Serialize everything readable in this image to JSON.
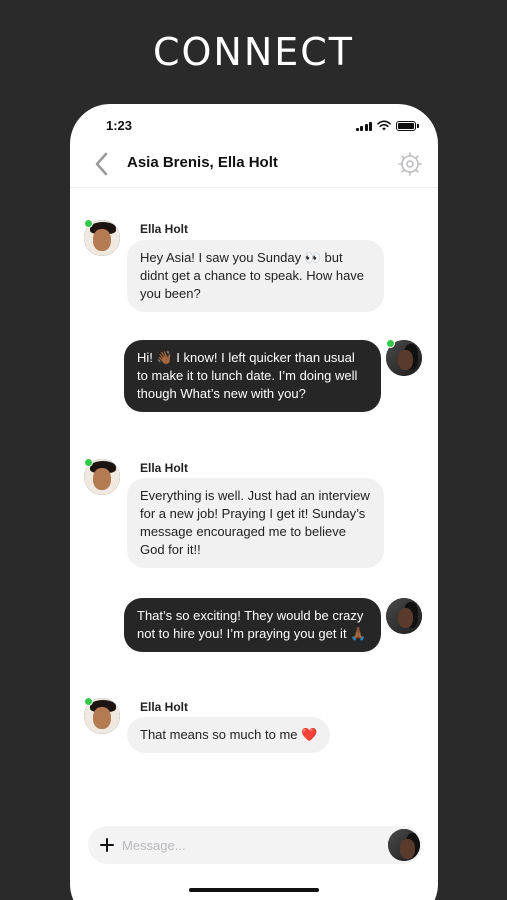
{
  "promo": {
    "title": "CONNECT"
  },
  "status_bar": {
    "time": "1:23"
  },
  "nav": {
    "title": "Asia Brenis, Ella Holt"
  },
  "messages": [
    {
      "direction": "incoming",
      "sender": "Ella Holt",
      "text": "Hey Asia! I saw you Sunday 👀 but didnt get a chance to speak. How have you been?"
    },
    {
      "direction": "outgoing",
      "text": "Hi! 👋🏾 I know! I left quicker than usual to make it to lunch date. I’m doing well though What’s new with you?"
    },
    {
      "direction": "incoming",
      "sender": "Ella Holt",
      "text": "Everything is well. Just had an interview for a new job! Praying I get it! Sunday’s message encouraged me to believe God for it!!"
    },
    {
      "direction": "outgoing",
      "text": "That’s so exciting! They would be crazy not to hire you! I’m praying you get it 🙏🏾"
    },
    {
      "direction": "incoming",
      "sender": "Ella Holt",
      "text": "That means so much to me ❤️"
    }
  ],
  "composer": {
    "placeholder": "Message...",
    "value": ""
  },
  "colors": {
    "background": "#2a2a2b",
    "online": "#33c948",
    "outgoing_bubble": "#262626",
    "incoming_bubble": "#f1f1f2"
  },
  "icons": {
    "back": "chevron-left-icon",
    "settings": "gear-icon",
    "add": "plus-icon"
  }
}
